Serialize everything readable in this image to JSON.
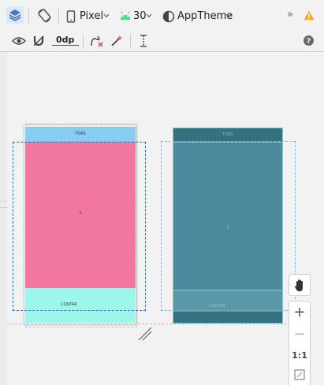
{
  "toolbar": {
    "device": "Pixel",
    "api_level": "30",
    "theme": "AppTheme",
    "overflow": "»",
    "dp_value": "0dp"
  },
  "design": {
    "top_label": "TOAS",
    "center_label": "1",
    "bottom_label": "CONTAR"
  },
  "blueprint": {
    "top_label": "TOAS",
    "center_label": "1",
    "bottom_label": "CONTAR"
  },
  "zoom": {
    "zoom_in": "+",
    "zoom_out": "−",
    "actual_size": "1:1"
  },
  "colors": {
    "design_top": "#86cdf2",
    "design_main": "#f2779f",
    "design_bottom": "#9cf7ea",
    "blueprint_bg": "#4a8a9c",
    "blueprint_dark": "#35717f",
    "warning": "#f5a623"
  }
}
